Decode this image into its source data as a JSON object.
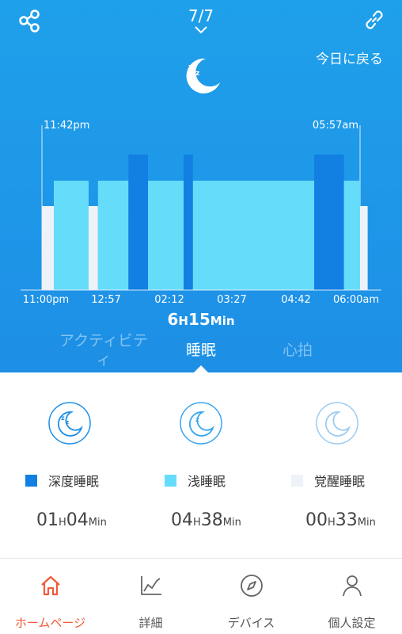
{
  "header": {
    "date": "7/7",
    "today_button": "今日に戻る",
    "icons": {
      "share": "share-icon",
      "date_dropdown": "chevron-down-icon",
      "link": "link-icon",
      "sleep": "moon-zz-icon"
    }
  },
  "chart_data": {
    "type": "bar",
    "start_label": "11:42pm",
    "end_label": "05:57am",
    "x_tick_labels": [
      "11:00pm",
      "12:57",
      "02:12",
      "03:27",
      "04:42",
      "06:00am"
    ],
    "x_range": [
      "23:00",
      "06:00"
    ],
    "levels": {
      "awake": 1,
      "light": 2,
      "deep": 3
    },
    "segments": [
      {
        "stage": "awake",
        "start": "23:42",
        "end": "23:56"
      },
      {
        "stage": "light",
        "start": "23:56",
        "end": "00:37"
      },
      {
        "stage": "awake",
        "start": "00:37",
        "end": "00:48"
      },
      {
        "stage": "light",
        "start": "00:48",
        "end": "01:24"
      },
      {
        "stage": "deep",
        "start": "01:24",
        "end": "01:47"
      },
      {
        "stage": "light",
        "start": "01:47",
        "end": "02:29"
      },
      {
        "stage": "deep",
        "start": "02:29",
        "end": "02:40"
      },
      {
        "stage": "light",
        "start": "02:40",
        "end": "05:03"
      },
      {
        "stage": "deep",
        "start": "05:03",
        "end": "05:38"
      },
      {
        "stage": "light",
        "start": "05:38",
        "end": "05:57"
      },
      {
        "stage": "awake",
        "start": "05:57",
        "end": "06:06"
      }
    ],
    "colors": {
      "deep": "#127fe2",
      "light": "#66dcfb",
      "awake": "#eef2f9"
    }
  },
  "duration": {
    "hours": "6",
    "h_unit": "H",
    "minutes": "15",
    "m_unit": "Min"
  },
  "tabs": {
    "activity": "アクティビティ",
    "sleep": "睡眠",
    "heart": "心拍"
  },
  "summary": {
    "deep": {
      "label": "深度睡眠",
      "hours": "01",
      "minutes": "04",
      "color": "#127fe2"
    },
    "light": {
      "label": "浅睡眠",
      "hours": "04",
      "minutes": "38",
      "color": "#66dcfb"
    },
    "awake": {
      "label": "覚醒睡眠",
      "hours": "00",
      "minutes": "33",
      "color": "#eef2f9"
    },
    "h_unit": "H",
    "m_unit": "Min"
  },
  "nav": [
    {
      "label": "ホームページ",
      "icon": "home-icon"
    },
    {
      "label": "詳細",
      "icon": "chart-icon"
    },
    {
      "label": "デバイス",
      "icon": "compass-icon"
    },
    {
      "label": "個人設定",
      "icon": "user-icon"
    }
  ]
}
